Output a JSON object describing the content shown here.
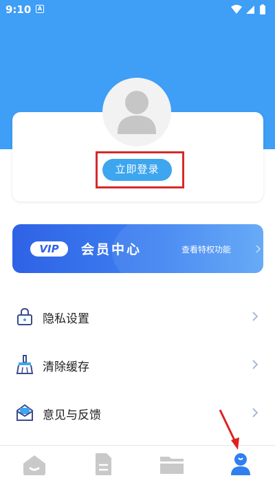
{
  "status_bar": {
    "time": "9:10",
    "notification_badge": "A"
  },
  "profile": {
    "login_button": "立即登录"
  },
  "vip": {
    "badge": "VIP",
    "title": "会员中心",
    "link": "查看特权功能"
  },
  "menu": [
    {
      "label": "隐私设置",
      "icon": "lock-icon"
    },
    {
      "label": "清除缓存",
      "icon": "broom-icon"
    },
    {
      "label": "意见与反馈",
      "icon": "mail-icon"
    }
  ],
  "bottom_nav": [
    {
      "icon": "home-icon",
      "active": false
    },
    {
      "icon": "document-icon",
      "active": false
    },
    {
      "icon": "folder-icon",
      "active": false
    },
    {
      "icon": "profile-icon",
      "active": true
    }
  ],
  "colors": {
    "header": "#3f9ef5",
    "accent": "#3da6ef",
    "vip_gradient_start": "#2f62e6",
    "vip_gradient_end": "#5aa4f7",
    "highlight": "#d42a2a",
    "nav_inactive": "#c9c9c9",
    "nav_active": "#2f7ff0"
  }
}
